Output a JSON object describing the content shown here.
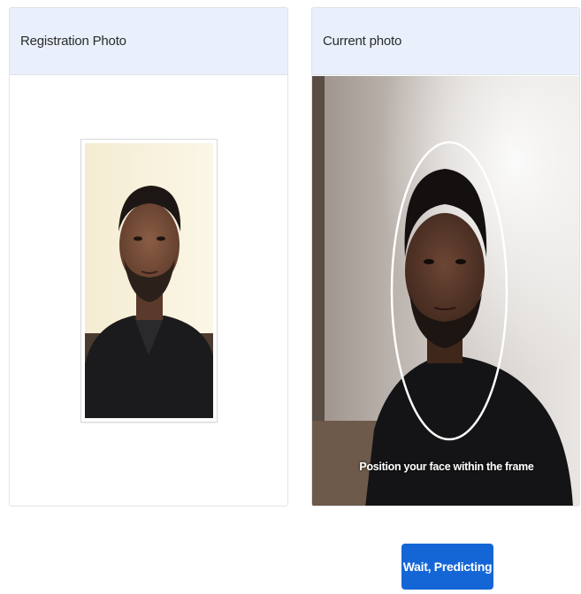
{
  "registration": {
    "title": "Registration Photo",
    "photo_icon": "person-portrait"
  },
  "current": {
    "title": "Current photo",
    "caption": "Position your face within the frame",
    "frame_icon": "face-oval-guide"
  },
  "action": {
    "button_label": "Wait, Predicting"
  },
  "colors": {
    "header_bg": "#e9f0fb",
    "button_bg": "#1466d6"
  }
}
